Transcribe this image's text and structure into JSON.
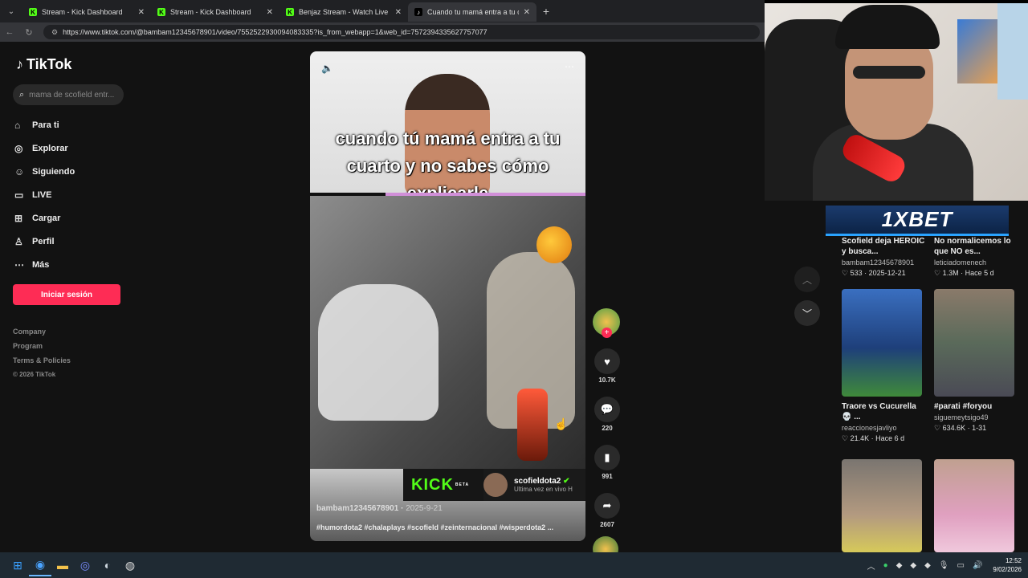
{
  "browser": {
    "tabs": [
      {
        "label": "Stream - Kick Dashboard",
        "icon": "kick-icon",
        "active": false
      },
      {
        "label": "Stream - Kick Dashboard",
        "icon": "kick-icon",
        "active": false
      },
      {
        "label": "Benjaz Stream - Watch Live on Kick",
        "icon": "kick-icon",
        "active": false
      },
      {
        "label": "Cuando tu mamá entra a tu cuarto",
        "icon": "tiktok-icon",
        "active": true
      }
    ],
    "url": "https://www.tiktok.com/@bambam12345678901/video/7552522930094083335?is_from_webapp=1&web_id=7572394335627757077"
  },
  "sidebar": {
    "logo": "TikTok",
    "search_placeholder": "mama de scofield entr...",
    "menu": [
      {
        "label": "Para ti",
        "icon": "home-icon"
      },
      {
        "label": "Explorar",
        "icon": "compass-icon"
      },
      {
        "label": "Siguiendo",
        "icon": "following-icon"
      },
      {
        "label": "LIVE",
        "icon": "live-icon"
      },
      {
        "label": "Cargar",
        "icon": "upload-icon"
      },
      {
        "label": "Perfil",
        "icon": "profile-icon"
      },
      {
        "label": "Más",
        "icon": "more-icon"
      }
    ],
    "login_label": "Iniciar sesión",
    "footer": [
      "Company",
      "Program",
      "Terms & Policies"
    ],
    "copyright": "© 2026 TikTok"
  },
  "video": {
    "caption_line1": "cuando tú mamá entra a tu",
    "caption_line2": "cuarto y no sabes cómo explicarle",
    "author": "bambam12345678901",
    "date": "2025-9-21",
    "tags": "#humordota2 #chalaplays #scofield #zeinternacional #wisperdota2 ...",
    "kick_overlay": {
      "logo": "KICK",
      "beta": "BETA",
      "channel": "scofieldota2",
      "status": "Ultima vez en vivo H"
    }
  },
  "actions": {
    "likes": "10.7K",
    "comments": "220",
    "saves": "991",
    "shares": "2607"
  },
  "recommendations": [
    {
      "title": "Scofield deja HEROIC y busca...",
      "user": "bambam12345678901",
      "likes": "533",
      "date": "2025-12-21",
      "color": "#3a3a3a"
    },
    {
      "title": "No normalicemos lo que NO es...",
      "user": "leticiadomenech",
      "likes": "1.3M",
      "date": "Hace 5 d",
      "color": "#444"
    },
    {
      "title": "Traore vs Cucurella 💀 ...",
      "user": "reaccionesjavliyo",
      "likes": "21.4K",
      "date": "Hace 6 d",
      "color": "#2d4f8a"
    },
    {
      "title": "#parati #foryou",
      "user": "siguemeytsigo49",
      "likes": "634.6K",
      "date": "1-31",
      "color": "#6b6b5a"
    },
    {
      "title": "",
      "user": "",
      "likes": "",
      "date": "",
      "color": "#8a7a6a"
    },
    {
      "title": "",
      "user": "",
      "likes": "",
      "date": "",
      "color": "#d88ab0"
    }
  ],
  "banner": {
    "text": "1XBET"
  },
  "taskbar": {
    "time": "12:52",
    "date": "9/02/2026"
  }
}
